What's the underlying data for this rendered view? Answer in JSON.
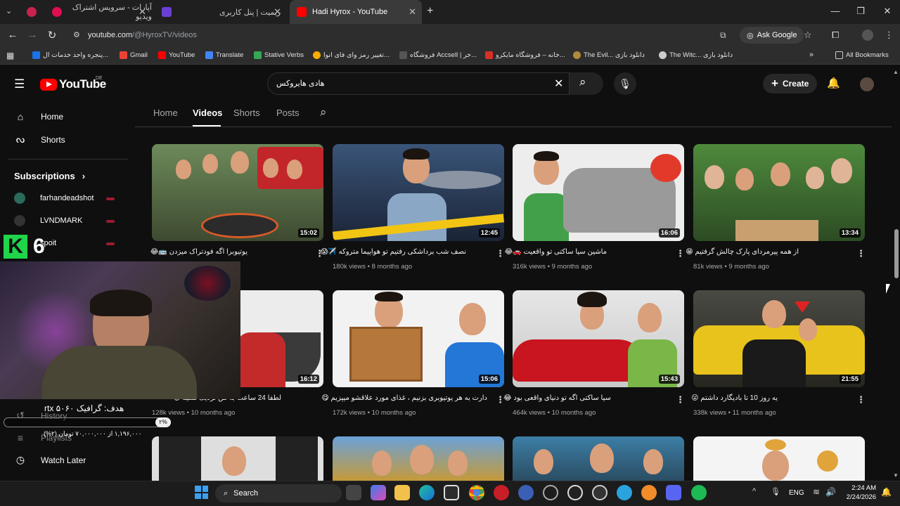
{
  "browser": {
    "tabs": [
      {
        "label": "آپارات - سرویس اشتراک ویدیو",
        "active": false
      },
      {
        "label": "ریمیت | پنل کاربری",
        "active": false
      },
      {
        "label": "Hadi Hyrox - YouTube",
        "active": true
      }
    ],
    "url_host": "youtube.com",
    "url_path": "/@HyroxTV/videos",
    "ask_google": "Ask Google",
    "bookmarks": [
      {
        "label": "پنجره واحد خدمات ال...",
        "color": "#1a73e8"
      },
      {
        "label": "Gmail",
        "color": "#ea4335"
      },
      {
        "label": "YouTube",
        "color": "#ff0000"
      },
      {
        "label": "Translate",
        "color": "#4285f4"
      },
      {
        "label": "Stative Verbs",
        "color": "#34a853"
      },
      {
        "label": "تغییر رمز وای فای انوا...",
        "color": "#f9ab00"
      },
      {
        "label": "فروشگاه Accsell | خر...",
        "color": "#444"
      },
      {
        "label": "خانه – فروشگاه مایکرو...",
        "color": "#d93025"
      },
      {
        "label": "The Evil... دانلود بازی",
        "color": "#b08a3a"
      },
      {
        "label": "The Witc... دانلود بازی",
        "color": "#cccccc"
      }
    ],
    "all_bookmarks": "All Bookmarks"
  },
  "youtube": {
    "logo_text": "YouTube",
    "country_code": "DE",
    "search_value": "هادی هایروکس",
    "create_label": "Create",
    "sidebar": {
      "home": "Home",
      "shorts": "Shorts",
      "subscriptions": "Subscriptions",
      "subs": [
        {
          "name": "farhandeadshot",
          "color": "#2a6b5c"
        },
        {
          "name": "LVNDMARK",
          "color": "#333333"
        },
        {
          "name": "spoit",
          "color": "#444444"
        }
      ],
      "history": "History",
      "playlists": "Playlists",
      "watch_later": "Watch Later"
    },
    "channel_tabs": [
      "Home",
      "Videos",
      "Shorts",
      "Posts"
    ],
    "videos": [
      {
        "title": "یوتیوبرا اگه فودتراک میزدن 🚌😂",
        "views": "",
        "age": "",
        "duration": "15:02",
        "bg": "#5b6b4a"
      },
      {
        "title": "نصف شب برداشکی رفتیم تو هواپیما متروکه ✈️😱",
        "views": "180k views",
        "age": "8 months ago",
        "duration": "12:45",
        "bg": "#2b3a52"
      },
      {
        "title": "ماشین سیا ساکتی تو واقعیت 🚗😂",
        "views": "316k views",
        "age": "9 months ago",
        "duration": "16:06",
        "bg": "#e9e9e9"
      },
      {
        "title": "از همه پیرمردای پارک چالش گرفتیم 😁",
        "views": "81k views",
        "age": "9 months ago",
        "duration": "13:34",
        "bg": "#3f6a2e"
      },
      {
        "title": "لطفا 24 ساعت به من نزدیک نشید 😂",
        "views": "128k views",
        "age": "10 months ago",
        "duration": "16:12",
        "bg": "#ececec"
      },
      {
        "title": "دارت به هر یوتیوبری بزنیم ، غذای مورد علاقشو میپزیم 😋",
        "views": "172k views",
        "age": "10 months ago",
        "duration": "15:06",
        "bg": "#f2f2f2"
      },
      {
        "title": "سیا ساکتی اگه تو دنیای واقعی بود 😂",
        "views": "464k views",
        "age": "10 months ago",
        "duration": "15:43",
        "bg": "#dcdcdc"
      },
      {
        "title": "یه روز 10 تا بادیگارد داشتم 😜",
        "views": "338k views",
        "age": "11 months ago",
        "duration": "21:55",
        "bg": "#3a3a30"
      }
    ]
  },
  "overlay": {
    "kick_count": "6",
    "kick_letter": "K",
    "goal_text": "هدف: گرافیک rtx ۵۰۶۰",
    "goal_progress": "۲%",
    "goal_sub": "۱,۱۹۶,۰۰۰ از ۷۰,۰۰۰,۰۰۰ تومان (۲%)"
  },
  "taskbar": {
    "search_label": "Search",
    "lang": "ENG",
    "time": "2:24 AM",
    "date": "2/24/2026"
  }
}
